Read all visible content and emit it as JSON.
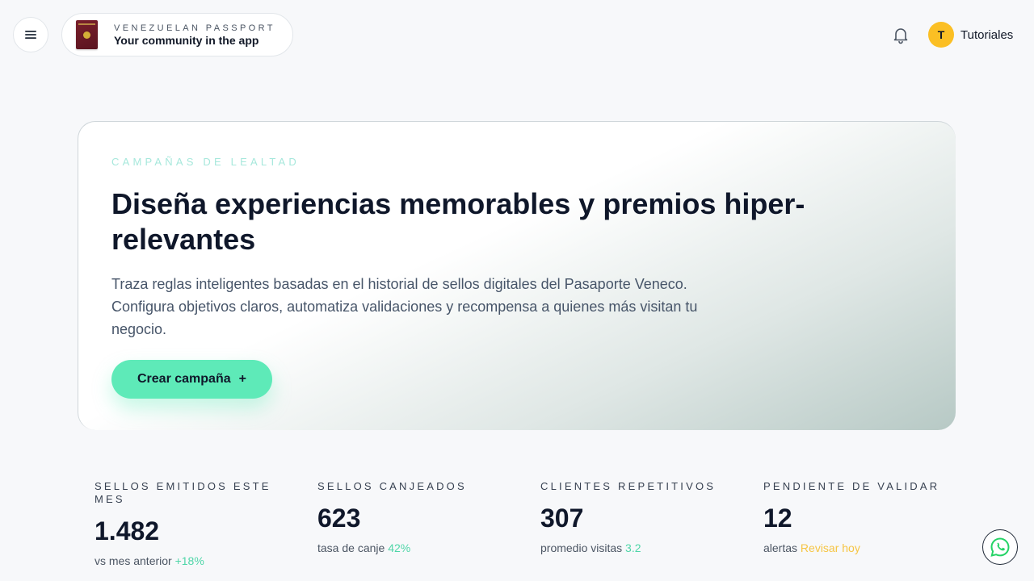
{
  "header": {
    "menu_icon": "hamburger-menu-icon",
    "brand": {
      "kicker": "VENEZUELAN PASSPORT",
      "title": "Your community in the app",
      "logo_icon": "passport-icon"
    },
    "notification_icon": "bell-icon",
    "user": {
      "initial": "T",
      "name": "Tutoriales",
      "avatar_color": "#fbbf24"
    }
  },
  "hero": {
    "kicker": "CAMPAÑAS DE LEALTAD",
    "title": "Diseña experiencias memorables y premios hiper-relevantes",
    "description": "Traza reglas inteligentes basadas en el historial de sellos digitales del Pasaporte Veneco. Configura objetivos claros, automatiza validaciones y recompensa a quienes más visitan tu negocio.",
    "cta_label": "Crear campaña",
    "cta_icon": "+",
    "cta_color": "#5eeab8"
  },
  "stats": [
    {
      "label": "SELLOS EMITIDOS ESTE MES",
      "value": "1.482",
      "sub_text": "vs mes anterior",
      "sub_value": "+18%"
    },
    {
      "label": "SELLOS CANJEADOS",
      "value": "623",
      "sub_text": "tasa de canje",
      "sub_value": "42%"
    },
    {
      "label": "CLIENTES REPETITIVOS",
      "value": "307",
      "sub_text": "promedio visitas",
      "sub_value": "3.2"
    },
    {
      "label": "PENDIENTE DE VALIDAR",
      "value": "12",
      "sub_text": "alertas",
      "sub_value": "Revisar hoy"
    }
  ],
  "colors": {
    "accent_green": "#4fd6a8",
    "warning_yellow": "#f6c544"
  },
  "floating_icon": "whatsapp-icon"
}
